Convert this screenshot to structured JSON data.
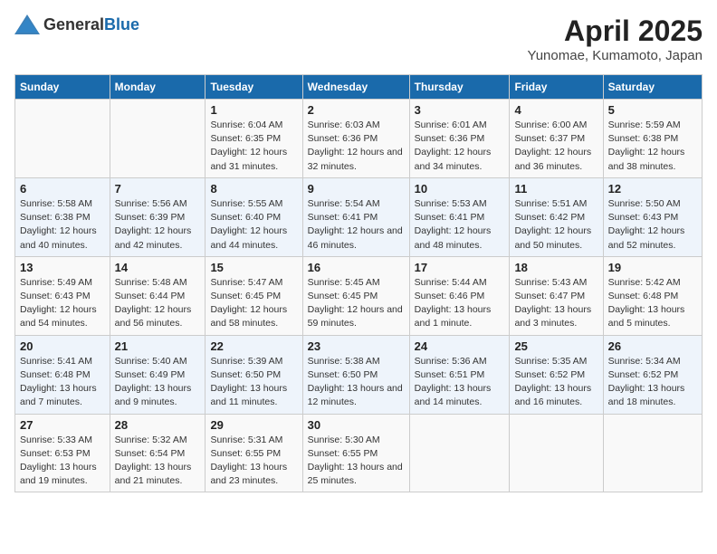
{
  "header": {
    "logo_general": "General",
    "logo_blue": "Blue",
    "title": "April 2025",
    "subtitle": "Yunomae, Kumamoto, Japan"
  },
  "calendar": {
    "days_of_week": [
      "Sunday",
      "Monday",
      "Tuesday",
      "Wednesday",
      "Thursday",
      "Friday",
      "Saturday"
    ],
    "weeks": [
      [
        {
          "day": "",
          "detail": ""
        },
        {
          "day": "",
          "detail": ""
        },
        {
          "day": "1",
          "detail": "Sunrise: 6:04 AM\nSunset: 6:35 PM\nDaylight: 12 hours and 31 minutes."
        },
        {
          "day": "2",
          "detail": "Sunrise: 6:03 AM\nSunset: 6:36 PM\nDaylight: 12 hours and 32 minutes."
        },
        {
          "day": "3",
          "detail": "Sunrise: 6:01 AM\nSunset: 6:36 PM\nDaylight: 12 hours and 34 minutes."
        },
        {
          "day": "4",
          "detail": "Sunrise: 6:00 AM\nSunset: 6:37 PM\nDaylight: 12 hours and 36 minutes."
        },
        {
          "day": "5",
          "detail": "Sunrise: 5:59 AM\nSunset: 6:38 PM\nDaylight: 12 hours and 38 minutes."
        }
      ],
      [
        {
          "day": "6",
          "detail": "Sunrise: 5:58 AM\nSunset: 6:38 PM\nDaylight: 12 hours and 40 minutes."
        },
        {
          "day": "7",
          "detail": "Sunrise: 5:56 AM\nSunset: 6:39 PM\nDaylight: 12 hours and 42 minutes."
        },
        {
          "day": "8",
          "detail": "Sunrise: 5:55 AM\nSunset: 6:40 PM\nDaylight: 12 hours and 44 minutes."
        },
        {
          "day": "9",
          "detail": "Sunrise: 5:54 AM\nSunset: 6:41 PM\nDaylight: 12 hours and 46 minutes."
        },
        {
          "day": "10",
          "detail": "Sunrise: 5:53 AM\nSunset: 6:41 PM\nDaylight: 12 hours and 48 minutes."
        },
        {
          "day": "11",
          "detail": "Sunrise: 5:51 AM\nSunset: 6:42 PM\nDaylight: 12 hours and 50 minutes."
        },
        {
          "day": "12",
          "detail": "Sunrise: 5:50 AM\nSunset: 6:43 PM\nDaylight: 12 hours and 52 minutes."
        }
      ],
      [
        {
          "day": "13",
          "detail": "Sunrise: 5:49 AM\nSunset: 6:43 PM\nDaylight: 12 hours and 54 minutes."
        },
        {
          "day": "14",
          "detail": "Sunrise: 5:48 AM\nSunset: 6:44 PM\nDaylight: 12 hours and 56 minutes."
        },
        {
          "day": "15",
          "detail": "Sunrise: 5:47 AM\nSunset: 6:45 PM\nDaylight: 12 hours and 58 minutes."
        },
        {
          "day": "16",
          "detail": "Sunrise: 5:45 AM\nSunset: 6:45 PM\nDaylight: 12 hours and 59 minutes."
        },
        {
          "day": "17",
          "detail": "Sunrise: 5:44 AM\nSunset: 6:46 PM\nDaylight: 13 hours and 1 minute."
        },
        {
          "day": "18",
          "detail": "Sunrise: 5:43 AM\nSunset: 6:47 PM\nDaylight: 13 hours and 3 minutes."
        },
        {
          "day": "19",
          "detail": "Sunrise: 5:42 AM\nSunset: 6:48 PM\nDaylight: 13 hours and 5 minutes."
        }
      ],
      [
        {
          "day": "20",
          "detail": "Sunrise: 5:41 AM\nSunset: 6:48 PM\nDaylight: 13 hours and 7 minutes."
        },
        {
          "day": "21",
          "detail": "Sunrise: 5:40 AM\nSunset: 6:49 PM\nDaylight: 13 hours and 9 minutes."
        },
        {
          "day": "22",
          "detail": "Sunrise: 5:39 AM\nSunset: 6:50 PM\nDaylight: 13 hours and 11 minutes."
        },
        {
          "day": "23",
          "detail": "Sunrise: 5:38 AM\nSunset: 6:50 PM\nDaylight: 13 hours and 12 minutes."
        },
        {
          "day": "24",
          "detail": "Sunrise: 5:36 AM\nSunset: 6:51 PM\nDaylight: 13 hours and 14 minutes."
        },
        {
          "day": "25",
          "detail": "Sunrise: 5:35 AM\nSunset: 6:52 PM\nDaylight: 13 hours and 16 minutes."
        },
        {
          "day": "26",
          "detail": "Sunrise: 5:34 AM\nSunset: 6:52 PM\nDaylight: 13 hours and 18 minutes."
        }
      ],
      [
        {
          "day": "27",
          "detail": "Sunrise: 5:33 AM\nSunset: 6:53 PM\nDaylight: 13 hours and 19 minutes."
        },
        {
          "day": "28",
          "detail": "Sunrise: 5:32 AM\nSunset: 6:54 PM\nDaylight: 13 hours and 21 minutes."
        },
        {
          "day": "29",
          "detail": "Sunrise: 5:31 AM\nSunset: 6:55 PM\nDaylight: 13 hours and 23 minutes."
        },
        {
          "day": "30",
          "detail": "Sunrise: 5:30 AM\nSunset: 6:55 PM\nDaylight: 13 hours and 25 minutes."
        },
        {
          "day": "",
          "detail": ""
        },
        {
          "day": "",
          "detail": ""
        },
        {
          "day": "",
          "detail": ""
        }
      ]
    ]
  }
}
